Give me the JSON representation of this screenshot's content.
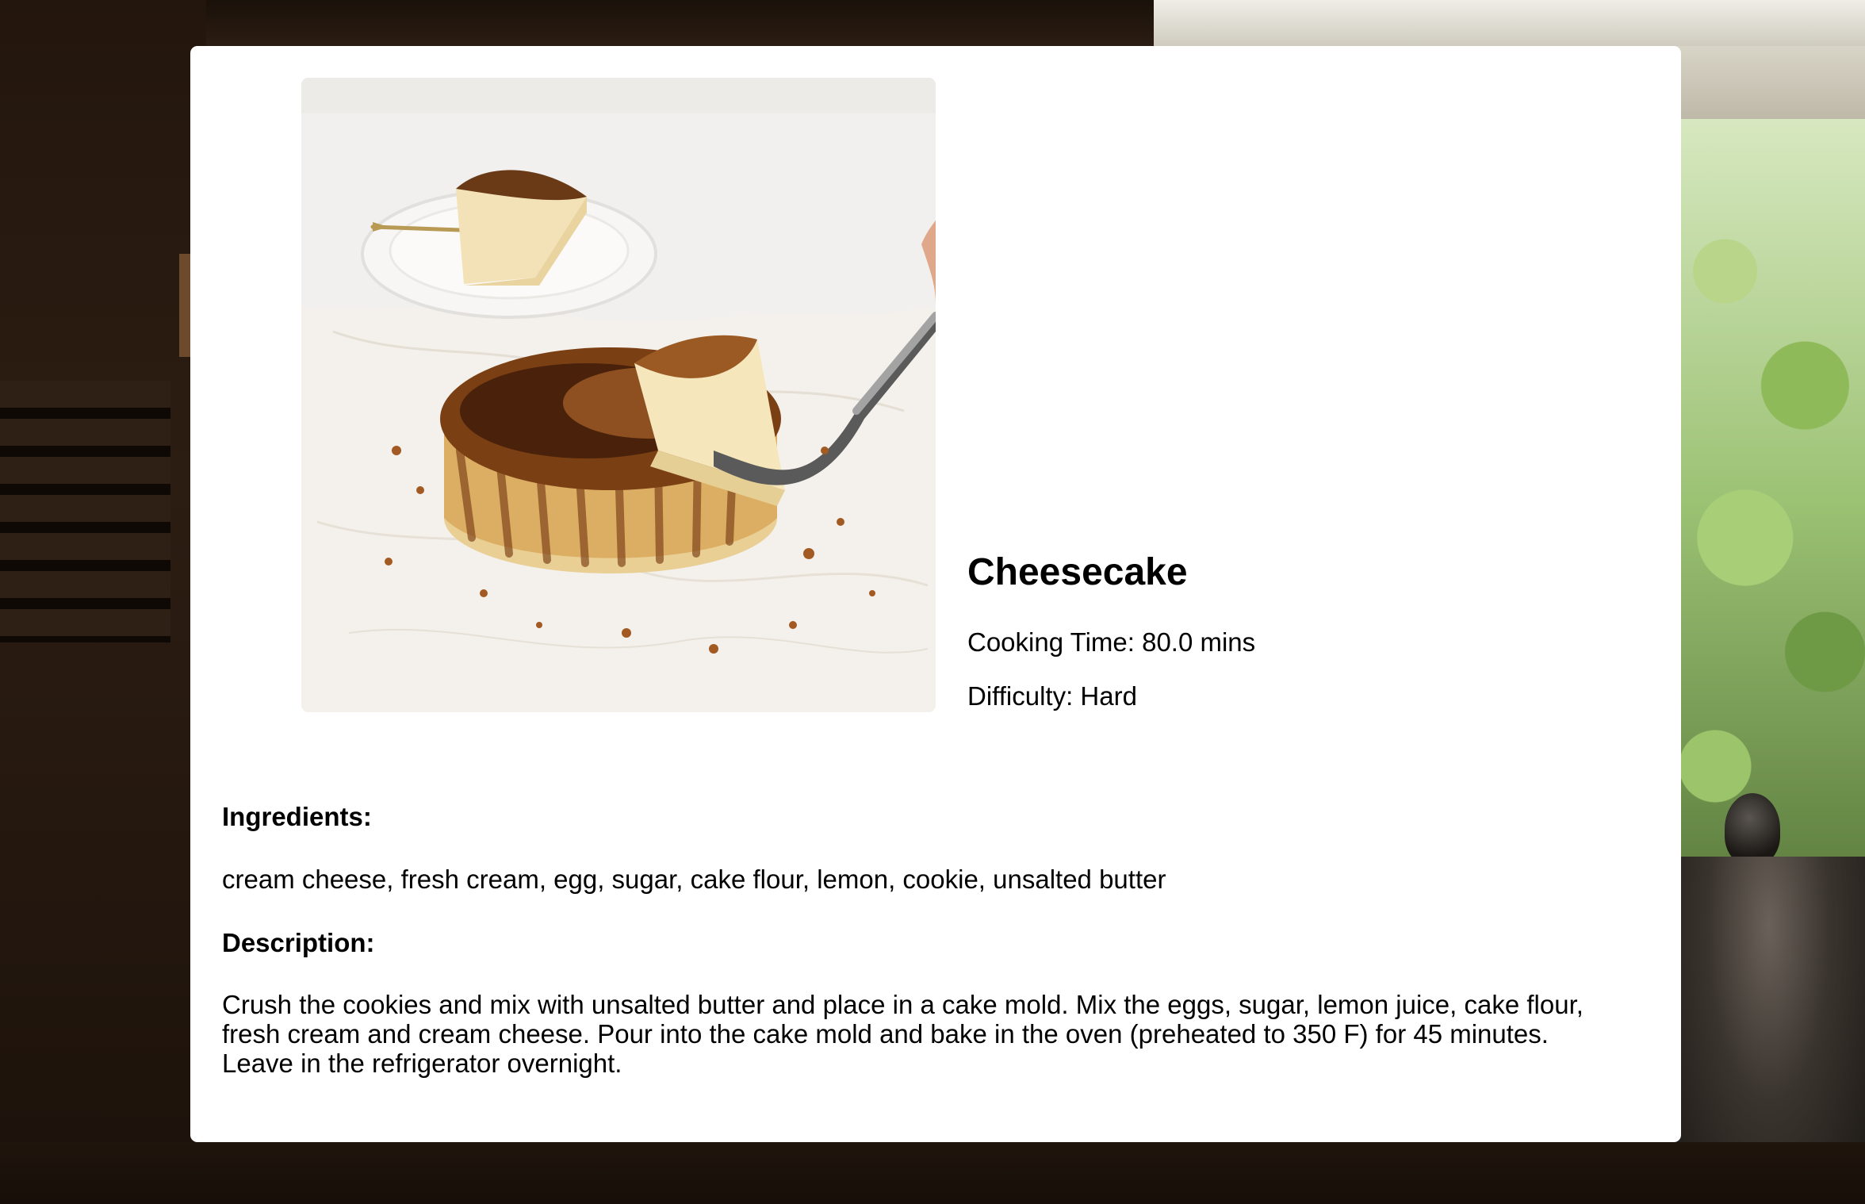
{
  "recipe": {
    "title": "Cheesecake",
    "cooking_time": "Cooking Time: 80.0 mins",
    "difficulty": "Difficulty: Hard",
    "ingredients_heading": "Ingredients:",
    "ingredients": "cream cheese, fresh cream, egg, sugar, cake flour, lemon, cookie, unsalted butter",
    "description_heading": "Description:",
    "description": "Crush the cookies and mix with unsalted butter and place in a cake mold. Mix the eggs, sugar, lemon juice, cake flour, fresh cream and cream cheese. Pour into the cake mold and bake in the oven (preheated to 350 F) for 45 minutes. Leave in the refrigerator overnight."
  },
  "colors": {
    "card_background": "#ffffff",
    "text": "#000000"
  }
}
